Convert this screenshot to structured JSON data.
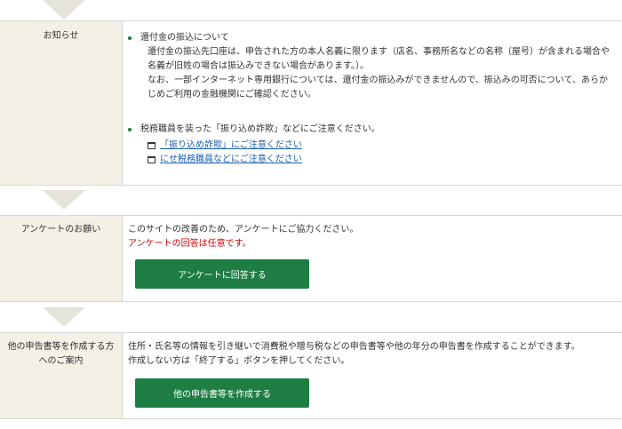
{
  "notice": {
    "label": "お知らせ",
    "item1": {
      "title": "還付金の振込について",
      "lines": [
        "還付金の振込先口座は、申告された方の本人名義に限ります（店名、事務所名などの名称（屋号）が含まれる場合や",
        "名義が旧姓の場合は振込みできない場合があります。）。",
        "なお、一部インターネット専用銀行については、還付金の振込みができませんので、振込みの可否について、あらか",
        "じめご利用の金融機関にご確認ください。"
      ]
    },
    "item2": {
      "title": "税務職員を装った「振り込め詐欺」などにご注意ください。",
      "links": [
        "「振り込め詐欺」にご注意ください",
        "にせ税務職員などにご注意ください"
      ]
    }
  },
  "survey": {
    "label": "アンケートのお願い",
    "text": "このサイトの改善のため、アンケートにご協力ください。",
    "note": "アンケートの回答は任意です。",
    "button": "アンケートに回答する"
  },
  "other": {
    "label_line1": "他の申告書等を作成する方",
    "label_line2": "へのご案内",
    "text1": "住所・氏名等の情報を引き継いで消費税や贈与税などの申告書等や他の年分の申告書を作成することができます。",
    "text2": "作成しない方は「終了する」ボタンを押してください。",
    "button": "他の申告書等を作成する"
  }
}
